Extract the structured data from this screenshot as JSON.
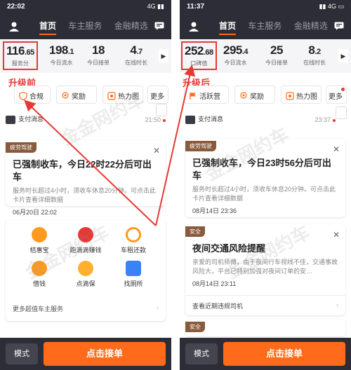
{
  "colors": {
    "accent": "#ff6b1a",
    "highlight": "#e53935",
    "dark_header": "#2c2d36",
    "badge_brown": "#8a5a3c"
  },
  "watermark": "金金网约车",
  "left": {
    "status": {
      "time": "22:02",
      "signal": "4G"
    },
    "nav": {
      "tabs": [
        "首页",
        "车主服务",
        "金融精选"
      ]
    },
    "stats": [
      {
        "value": "116",
        "decimal": ".65",
        "label": "服务分"
      },
      {
        "value": "198",
        "decimal": ".1",
        "label": "今日流水"
      },
      {
        "value": "18",
        "decimal": "",
        "label": "今日接单"
      },
      {
        "value": "4",
        "decimal": ".7",
        "label": "在线时长"
      }
    ],
    "upgrade_label": "升级前",
    "quick": [
      "合规",
      "奖励",
      "热力图",
      "更多"
    ],
    "payment": {
      "label": "支付消息",
      "time": "21:50"
    },
    "card": {
      "badge": "疲劳驾驶",
      "title": "已强制收车，今日22时22分后可出车",
      "body": "服务时长超过4小时，须收车休息20分钟。可点击此卡片查看详细数据",
      "time": "06月20日 22:02"
    },
    "services": [
      {
        "label": "桔惠宝",
        "icon": "orange-drop-icon"
      },
      {
        "label": "跑滴滴赚钱",
        "icon": "red-money-bag-icon"
      },
      {
        "label": "车租还款",
        "icon": "orange-cycle-icon"
      },
      {
        "label": "借钱",
        "icon": "yen-drop-icon"
      },
      {
        "label": "点滴保",
        "icon": "mask-icon"
      },
      {
        "label": "找厕所",
        "icon": "restroom-icon"
      }
    ],
    "services_more": "更多超值车主服务",
    "bottom": {
      "mode": "模式",
      "take": "点击接单"
    }
  },
  "right": {
    "status": {
      "time": "11:37",
      "signal": "4G"
    },
    "nav": {
      "tabs": [
        "首页",
        "车主服务",
        "金融精选"
      ]
    },
    "stats": [
      {
        "value": "252",
        "decimal": ".68",
        "label": "口碑值"
      },
      {
        "value": "295",
        "decimal": ".4",
        "label": "今日流水"
      },
      {
        "value": "25",
        "decimal": "",
        "label": "今日接单"
      },
      {
        "value": "8",
        "decimal": ".2",
        "label": "在线时长"
      }
    ],
    "upgrade_label": "升级后",
    "quick": [
      "活跃营",
      "奖励",
      "热力图",
      "更多"
    ],
    "payment": {
      "label": "支付消息",
      "time": "23:37"
    },
    "card": {
      "badge": "疲劳驾驶",
      "title": "已强制收车，今日23时56分后可出车",
      "body": "服务时长超过4小时，须收车休息20分钟。可点击此卡片查看详细数据",
      "time": "08月14日 23:36"
    },
    "card2": {
      "badge": "安全",
      "title": "夜间交通风险提醒",
      "body": "亲爱的司机师傅，由于夜间行车视线不佳，交通事故风险大，平台已特别加强对夜间订单的安…",
      "time": "08月14日 23:11",
      "link": "查看近期违规司机"
    },
    "card3": {
      "badge": "安全"
    },
    "bottom": {
      "mode": "模式",
      "take": "点击接单"
    }
  }
}
